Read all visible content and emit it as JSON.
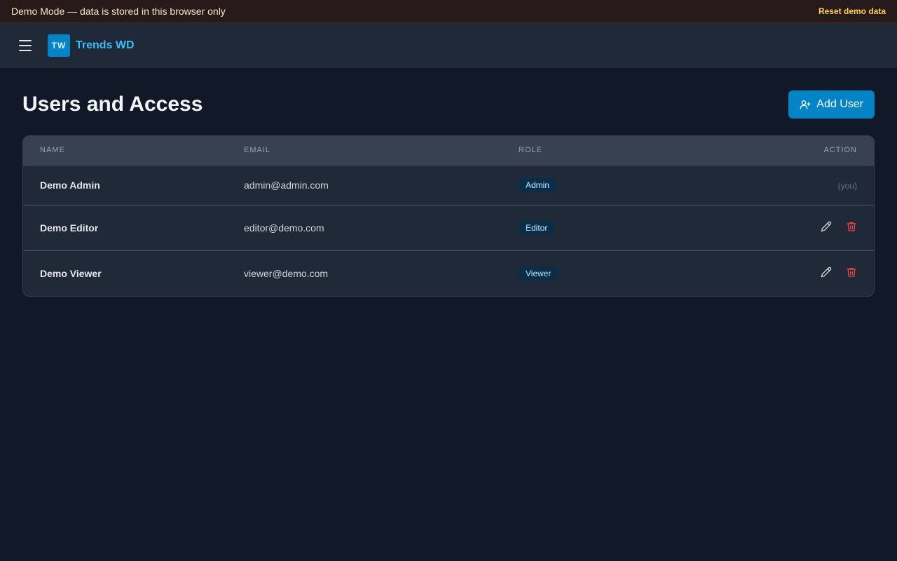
{
  "banner": {
    "message": "Demo Mode — data is stored in this browser only",
    "reset_label": "Reset demo data"
  },
  "topbar": {
    "logo_text": "TW",
    "brand": "Trends WD",
    "menu_icon": "hamburger-menu-icon"
  },
  "page": {
    "title": "Users and Access",
    "add_button_label": "Add User",
    "add_button_icon": "user-plus-icon"
  },
  "table": {
    "columns": [
      "NAME",
      "EMAIL",
      "ROLE",
      "ACTION"
    ],
    "rows": [
      {
        "name": "Demo Admin",
        "email": "admin@admin.com",
        "role": "Admin",
        "action": "(you)"
      },
      {
        "name": "Demo Editor",
        "email": "editor@demo.com",
        "role": "Editor"
      },
      {
        "name": "Demo Viewer",
        "email": "viewer@demo.com",
        "role": "Viewer"
      }
    ]
  },
  "colors": {
    "accent": "#0284c7",
    "brand_text": "#38bdf8",
    "delete": "#ef4444",
    "background": "#111827"
  }
}
